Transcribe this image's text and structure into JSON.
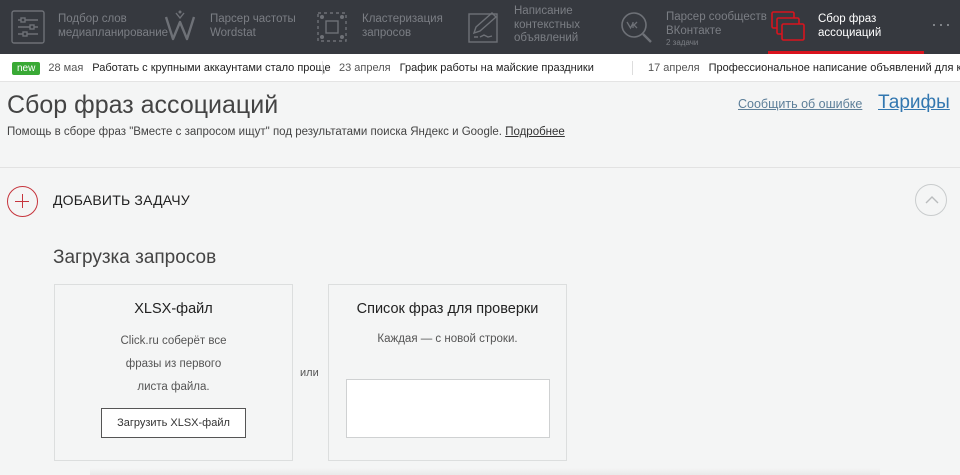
{
  "nav": {
    "tools": [
      {
        "label_1": "Подбор слов",
        "label_2": "медиапланирование",
        "icon": "sliders-icon"
      },
      {
        "label_1": "Парсер частоты",
        "label_2": "Wordstat",
        "icon": "wordstat-w-icon"
      },
      {
        "label_1": "Кластеризация",
        "label_2": "запросов",
        "icon": "cluster-icon"
      },
      {
        "label_1": "Написание",
        "label_2": "контекстных",
        "label_3": "объявлений",
        "icon": "pen-document-icon"
      },
      {
        "label_1": "Парсер сообществ",
        "label_2": "ВКонтакте",
        "sub": "2 задачи",
        "icon": "vk-search-icon"
      },
      {
        "label_1": "Сбор фраз",
        "label_2": "ассоциаций",
        "icon": "stacked-cards-icon",
        "active": true
      }
    ],
    "more": "···"
  },
  "ticker": {
    "badge": "new",
    "items": [
      {
        "date": "28 мая",
        "text": "Работать с крупными аккаунтами стало проще"
      },
      {
        "date": "23 апреля",
        "text": "График работы на майские праздники"
      },
      {
        "date": "17 апреля",
        "text": "Профессиональное написание объявлений для кон"
      }
    ]
  },
  "page": {
    "title": "Сбор фраз ассоциаций",
    "subtitle": "Помощь в сборе фраз \"Вместе с запросом ищут\" под результатами поиска Яндекс и Google.",
    "more_link": "Подробнее",
    "report_link": "Сообщить об ошибке",
    "tariffs_link": "Тарифы"
  },
  "task": {
    "add_label": "ДОБАВИТЬ ЗАДАЧУ",
    "section_title": "Загрузка запросов",
    "or_label": "или",
    "xlsx": {
      "title": "XLSX-файл",
      "desc_1": "Click.ru соберёт все",
      "desc_2": "фразы из первого",
      "desc_3": "листа файла.",
      "button": "Загрузить XLSX-файл"
    },
    "list": {
      "title": "Список фраз для проверки",
      "desc": "Каждая — с новой строки.",
      "value": ""
    }
  },
  "colors": {
    "nav_bg": "#36393f",
    "accent_red": "#d9141e",
    "badge_green": "#39a935",
    "link_blue": "#3277b0"
  }
}
